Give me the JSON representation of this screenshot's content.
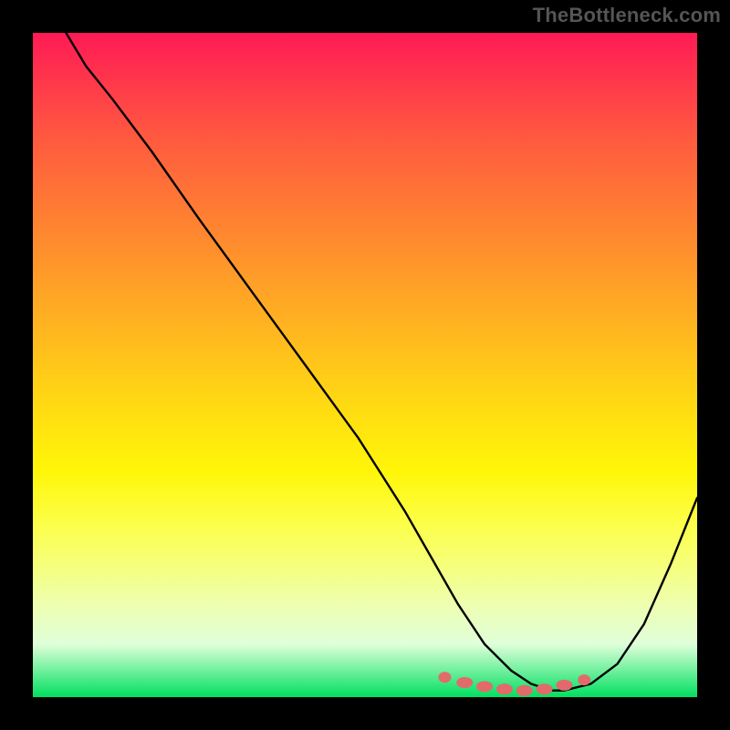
{
  "attribution": "TheBottleneck.com",
  "chart_data": {
    "type": "line",
    "title": "",
    "xlabel": "",
    "ylabel": "",
    "xlim": [
      0,
      100
    ],
    "ylim": [
      0,
      100
    ],
    "series": [
      {
        "name": "bottleneck-curve",
        "x": [
          5,
          8,
          12,
          18,
          25,
          33,
          41,
          49,
          56,
          60,
          64,
          68,
          72,
          75,
          78,
          80,
          84,
          88,
          92,
          96,
          100
        ],
        "values": [
          100,
          95,
          90,
          82,
          72,
          61,
          50,
          39,
          28,
          21,
          14,
          8,
          4,
          2,
          1,
          1,
          2,
          5,
          11,
          20,
          30
        ]
      }
    ],
    "markers": {
      "name": "optimal-range-dots",
      "color": "#e36a6a",
      "x": [
        62,
        65,
        68,
        71,
        74,
        77,
        80,
        83
      ],
      "values": [
        3.0,
        2.2,
        1.6,
        1.2,
        1.0,
        1.2,
        1.8,
        2.6
      ]
    },
    "gradient_stops": [
      {
        "pos": 0,
        "color": "#ff1a55"
      },
      {
        "pos": 50,
        "color": "#ffd400"
      },
      {
        "pos": 90,
        "color": "#f0ff80"
      },
      {
        "pos": 100,
        "color": "#00e060"
      }
    ]
  }
}
